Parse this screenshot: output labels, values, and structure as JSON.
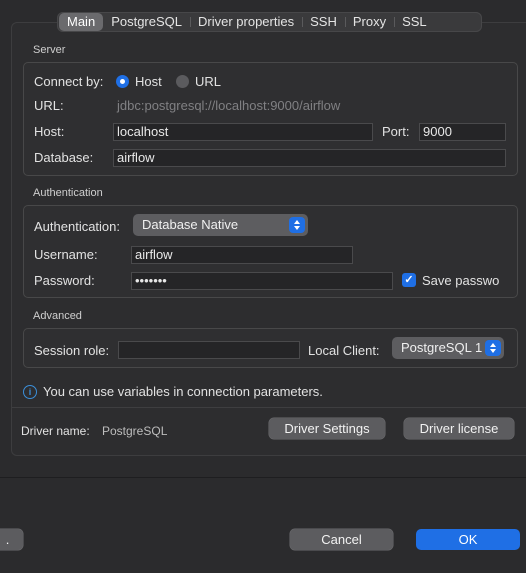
{
  "tabs": [
    "Main",
    "PostgreSQL",
    "Driver properties",
    "SSH",
    "Proxy",
    "SSL"
  ],
  "server": {
    "title": "Server",
    "connect_by_label": "Connect by:",
    "host_option": "Host",
    "url_option": "URL",
    "url_label": "URL:",
    "url_value": "jdbc:postgresql://localhost:9000/airflow",
    "host_label": "Host:",
    "host_value": "localhost",
    "port_label": "Port:",
    "port_value": "9000",
    "database_label": "Database:",
    "database_value": "airflow"
  },
  "auth": {
    "title": "Authentication",
    "auth_label": "Authentication:",
    "auth_value": "Database Native",
    "username_label": "Username:",
    "username_value": "airflow",
    "password_label": "Password:",
    "password_value": "•••••••",
    "save_password_label": "Save passwo"
  },
  "advanced": {
    "title": "Advanced",
    "session_role_label": "Session role:",
    "session_role_value": "",
    "local_client_label": "Local Client:",
    "local_client_value": "PostgreSQL 1"
  },
  "info": {
    "text": "You can use variables in connection parameters."
  },
  "driver": {
    "name_label": "Driver name:",
    "name_value": "PostgreSQL",
    "settings_button": "Driver Settings",
    "license_button": "Driver license"
  },
  "footer": {
    "left_button": ".",
    "cancel_button": "Cancel",
    "ok_button": "OK"
  },
  "colors": {
    "accent": "#1f6fe5",
    "background": "#2b2b2d"
  },
  "icons": [
    "info-icon",
    "chevron-updown-icon",
    "checkmark-icon"
  ]
}
